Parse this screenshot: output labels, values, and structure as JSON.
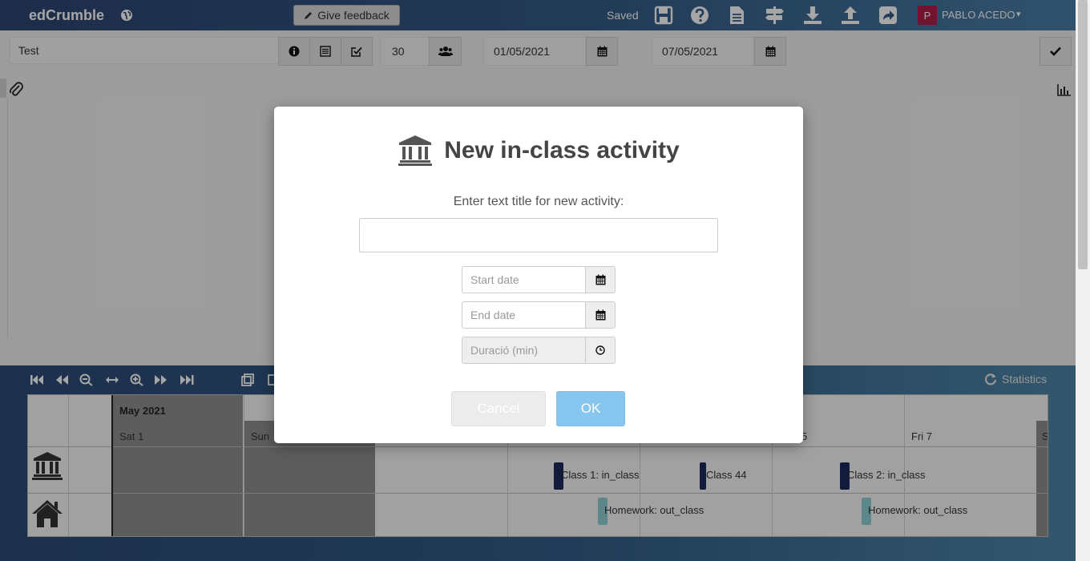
{
  "header": {
    "brand": "edCrumble",
    "feedback_label": "Give feedback",
    "saved_label": "Saved",
    "user_initial": "P",
    "user_name": "PABLO ACEDO",
    "icons": [
      "save-icon",
      "help-icon",
      "document-icon",
      "signpost-icon",
      "download-icon",
      "upload-icon",
      "share-icon"
    ]
  },
  "toolbar": {
    "design_title": "Test",
    "students": "30",
    "start_date": "01/05/2021",
    "end_date": "07/05/2021"
  },
  "timeline": {
    "statistics_label": "Statistics",
    "month": "May 2021",
    "days": [
      "Sat 1",
      "Sun",
      "5",
      "Fri 7",
      "S"
    ],
    "events": {
      "class1": "Class 1: in_class",
      "class44": "Class 44",
      "class2": "Class 2: in_class",
      "hw1": "Homework: out_class",
      "hw2": "Homework: out_class"
    }
  },
  "modal": {
    "title": "New in-class activity",
    "prompt": "Enter text title for new activity:",
    "title_value": "",
    "start_placeholder": "Start date",
    "end_placeholder": "End date",
    "duration_placeholder": "Duració (min)",
    "cancel_label": "Cancel",
    "ok_label": "OK"
  },
  "colors": {
    "header_start": "#2d4470",
    "header_end": "#4a7ea6",
    "avatar": "#b01f4a",
    "in_class_bar": "#1c2a5c",
    "out_class_bar": "#8ed0d6",
    "ok_button": "#87c6ef"
  }
}
